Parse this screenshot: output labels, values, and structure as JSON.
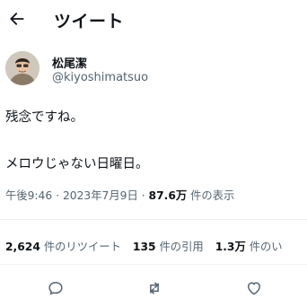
{
  "header": {
    "back_icon": "arrow-left-icon",
    "title": "ツイート"
  },
  "author": {
    "display_name": "松尾潔",
    "handle": "@kiyoshimatsuo",
    "avatar": "user-avatar"
  },
  "tweet": {
    "line1": "残念ですね。",
    "line2": "メロウじゃない日曜日。"
  },
  "meta": {
    "time": "午後9:46",
    "separator1": " · ",
    "date": "2023年7月9日",
    "separator2": " · ",
    "views_count": "87.6万",
    "views_label": " 件の表示"
  },
  "stats": {
    "retweets_count": "2,624",
    "retweets_label": " 件のリツイート",
    "quotes_count": "135",
    "quotes_label": " 件の引用",
    "likes_count": "1.3万",
    "likes_label": " 件のい"
  },
  "actions": {
    "reply_icon": "reply-icon",
    "retweet_icon": "retweet-icon",
    "like_icon": "heart-icon"
  },
  "colors": {
    "text": "#0f1419",
    "secondary": "#536471",
    "divider": "#eff3f4"
  }
}
